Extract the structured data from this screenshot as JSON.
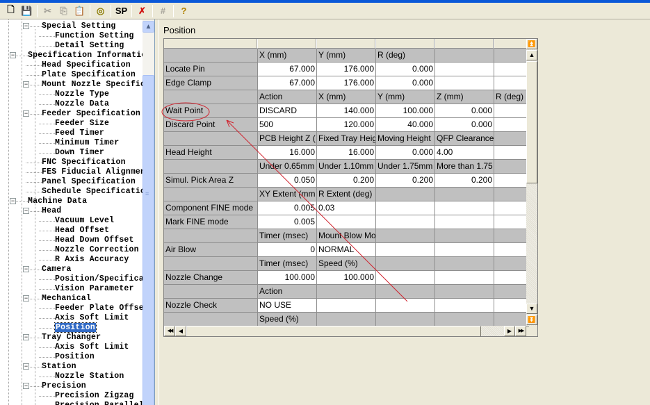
{
  "toolbar": {
    "buttons": [
      {
        "name": "new-icon",
        "glyph": "🗋",
        "enabled": true
      },
      {
        "name": "save-icon",
        "glyph": "💾",
        "enabled": true
      },
      {
        "name": "cut-icon",
        "glyph": "✂",
        "enabled": false
      },
      {
        "name": "copy-icon",
        "glyph": "⎘",
        "enabled": false
      },
      {
        "name": "paste-icon",
        "glyph": "📋",
        "enabled": false
      },
      {
        "name": "reel-icon",
        "glyph": "◎",
        "enabled": true
      },
      {
        "name": "sp-button",
        "glyph": "SP",
        "enabled": true
      },
      {
        "name": "disconnect-icon",
        "glyph": "✗",
        "enabled": true
      },
      {
        "name": "grid-icon",
        "glyph": "#",
        "enabled": false
      },
      {
        "name": "help-icon",
        "glyph": "?",
        "enabled": true
      }
    ]
  },
  "tree": {
    "items": [
      {
        "label": "Special Setting",
        "level": 2,
        "expander": true
      },
      {
        "label": "Function Setting",
        "level": 3
      },
      {
        "label": "Detail Setting",
        "level": 3
      },
      {
        "label": "Specification Information",
        "level": 1,
        "expander": true
      },
      {
        "label": "Head Specification",
        "level": 2
      },
      {
        "label": "Plate Specification",
        "level": 2
      },
      {
        "label": "Mount Nozzle Specificati",
        "level": 2,
        "expander": true
      },
      {
        "label": "Nozzle Type",
        "level": 3
      },
      {
        "label": "Nozzle Data",
        "level": 3
      },
      {
        "label": "Feeder Specification",
        "level": 2,
        "expander": true
      },
      {
        "label": "Feeder Size",
        "level": 3
      },
      {
        "label": "Feed Timer",
        "level": 3
      },
      {
        "label": "Minimum Timer",
        "level": 3
      },
      {
        "label": "Down Timer",
        "level": 3
      },
      {
        "label": "FNC Specification",
        "level": 2
      },
      {
        "label": "FES Fiducial Alignment",
        "level": 2
      },
      {
        "label": "Panel Specification",
        "level": 2
      },
      {
        "label": "Schedule Specification",
        "level": 2
      },
      {
        "label": "Machine Data",
        "level": 1,
        "expander": true
      },
      {
        "label": "Head",
        "level": 2,
        "expander": true
      },
      {
        "label": "Vacuum Level",
        "level": 3
      },
      {
        "label": "Head Offset",
        "level": 3
      },
      {
        "label": "Head Down Offset",
        "level": 3
      },
      {
        "label": "Nozzle Correction",
        "level": 3
      },
      {
        "label": "R Axis Accuracy",
        "level": 3
      },
      {
        "label": "Camera",
        "level": 2,
        "expander": true
      },
      {
        "label": "Position/Specificatio",
        "level": 3
      },
      {
        "label": "Vision Parameter",
        "level": 3
      },
      {
        "label": "Mechanical",
        "level": 2,
        "expander": true
      },
      {
        "label": "Feeder Plate Offset",
        "level": 3
      },
      {
        "label": "Axis Soft Limit",
        "level": 3
      },
      {
        "label": "Position",
        "level": 3,
        "selected": true
      },
      {
        "label": "Tray Changer",
        "level": 2,
        "expander": true
      },
      {
        "label": "Axis Soft Limit",
        "level": 3
      },
      {
        "label": "Position",
        "level": 3
      },
      {
        "label": "Station",
        "level": 2,
        "expander": true
      },
      {
        "label": "Nozzle Station",
        "level": 3
      },
      {
        "label": "Precision",
        "level": 2,
        "expander": true
      },
      {
        "label": "Precision Zigzag",
        "level": 3
      },
      {
        "label": "Precision Parallel",
        "level": 3
      }
    ]
  },
  "main": {
    "title": "Position",
    "grid": {
      "rows": [
        {
          "type": "header",
          "cells": [
            "",
            "",
            "",
            "",
            "",
            ""
          ]
        },
        {
          "type": "sub",
          "cells": [
            "",
            "X (mm)",
            "Y (mm)",
            "R (deg)",
            "",
            ""
          ]
        },
        {
          "type": "data",
          "cells": [
            "Locate Pin",
            "67.000",
            "176.000",
            "0.000",
            "",
            ""
          ],
          "align": [
            "l",
            "r",
            "r",
            "r",
            "l",
            "l"
          ]
        },
        {
          "type": "data",
          "cells": [
            "Edge Clamp",
            "67.000",
            "176.000",
            "0.000",
            "",
            ""
          ],
          "align": [
            "l",
            "r",
            "r",
            "r",
            "l",
            "l"
          ]
        },
        {
          "type": "sub",
          "cells": [
            "",
            "Action",
            "X (mm)",
            "Y (mm)",
            "Z (mm)",
            "R (deg)"
          ]
        },
        {
          "type": "data",
          "cells": [
            "Wait Point",
            "DISCARD",
            "140.000",
            "100.000",
            "0.000",
            ""
          ],
          "align": [
            "l",
            "l",
            "r",
            "r",
            "r",
            "l"
          ]
        },
        {
          "type": "data",
          "cells": [
            "Discard Point",
            "500",
            "120.000",
            "40.000",
            "0.000",
            ""
          ],
          "align": [
            "l",
            "l",
            "r",
            "r",
            "r",
            "l"
          ]
        },
        {
          "type": "sub",
          "cells": [
            "",
            "PCB Height Z (",
            "Fixed Tray Heig",
            "Moving Height",
            "QFP Clearance",
            ""
          ]
        },
        {
          "type": "data",
          "cells": [
            "Head Height",
            "16.000",
            "16.000",
            "0.000",
            "4.00",
            ""
          ],
          "align": [
            "l",
            "r",
            "r",
            "r",
            "l",
            "l"
          ]
        },
        {
          "type": "sub",
          "cells": [
            "",
            "Under 0.65mm",
            "Under 1.10mm",
            "Under 1.75mm",
            "More than 1.75",
            ""
          ]
        },
        {
          "type": "data",
          "cells": [
            "Simul. Pick Area Z",
            "0.050",
            "0.200",
            "0.200",
            "0.200",
            ""
          ],
          "align": [
            "l",
            "r",
            "r",
            "r",
            "r",
            "l"
          ]
        },
        {
          "type": "sub",
          "cells": [
            "",
            "XY Extent (mm",
            "R Extent (deg)",
            "",
            "",
            ""
          ]
        },
        {
          "type": "data",
          "cells": [
            "Component FINE mode",
            "0.005",
            "0.03",
            "",
            "",
            ""
          ],
          "align": [
            "l",
            "r",
            "l",
            "l",
            "l",
            "l"
          ]
        },
        {
          "type": "data",
          "cells": [
            "Mark FINE mode",
            "0.005",
            "",
            "",
            "",
            ""
          ],
          "align": [
            "l",
            "r",
            "l",
            "l",
            "l",
            "l"
          ]
        },
        {
          "type": "sub",
          "cells": [
            "",
            "Timer (msec)",
            "Mount Blow Mo",
            "",
            "",
            ""
          ]
        },
        {
          "type": "data",
          "cells": [
            "Air Blow",
            "0",
            "NORMAL",
            "",
            "",
            ""
          ],
          "align": [
            "l",
            "r",
            "l",
            "l",
            "l",
            "l"
          ]
        },
        {
          "type": "sub",
          "cells": [
            "",
            "Timer (msec)",
            "Speed (%)",
            "",
            "",
            ""
          ]
        },
        {
          "type": "data",
          "cells": [
            "Nozzle Change",
            "100.000",
            "100.000",
            "",
            "",
            ""
          ],
          "align": [
            "l",
            "r",
            "r",
            "l",
            "l",
            "l"
          ]
        },
        {
          "type": "sub",
          "cells": [
            "",
            "Action",
            "",
            "",
            "",
            ""
          ]
        },
        {
          "type": "data",
          "cells": [
            "Nozzle Check",
            "NO USE",
            "",
            "",
            "",
            ""
          ],
          "align": [
            "l",
            "l",
            "l",
            "l",
            "l",
            "l"
          ]
        },
        {
          "type": "sub",
          "cells": [
            "",
            "Speed (%)",
            "",
            "",
            "",
            ""
          ]
        }
      ]
    },
    "annotation": {
      "highlighted_cell": "Wait Point",
      "color": "#d0202c"
    }
  },
  "scroll": {
    "first_glyph": "⏫",
    "up_glyph": "▲",
    "down_glyph": "▼",
    "last_glyph": "⏬",
    "left_first_glyph": "◀◀",
    "left_glyph": "◀",
    "right_glyph": "▶",
    "right_last_glyph": "▶▶"
  }
}
